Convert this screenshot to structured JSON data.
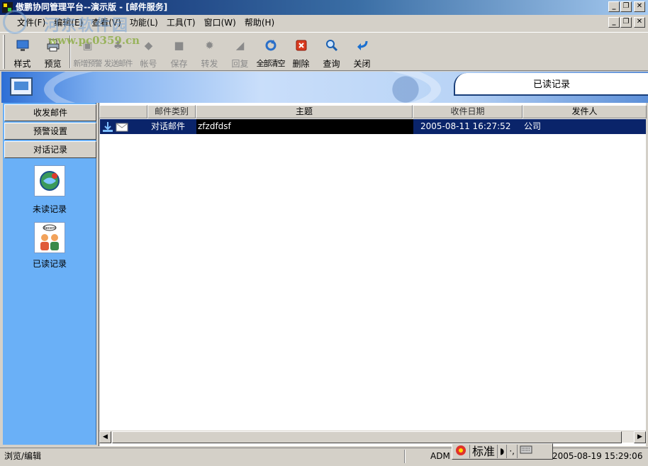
{
  "window": {
    "title": "傲鹏协同管理平台--演示版 - [邮件服务]",
    "minimize": "_",
    "restore": "❐",
    "close": "✕"
  },
  "watermark": {
    "url": "www.pc0359.cn",
    "site": "河东软件园"
  },
  "menu": [
    "文件(F)",
    "编辑(E)",
    "查看(V)",
    "功能(L)",
    "工具(T)",
    "窗口(W)",
    "帮助(H)"
  ],
  "toolbar": {
    "style": "样式",
    "preview": "预览",
    "new_warning": "新增预警",
    "send_mail": "发送邮件",
    "account": "帐号",
    "save": "保存",
    "forward": "转发",
    "reply": "回复",
    "clear_all": "全部清空",
    "delete": "删除",
    "query": "查询",
    "close": "关闭"
  },
  "banner": {
    "tab_title": "已读记录"
  },
  "leftnav": {
    "buttons": [
      "收发邮件",
      "预警设置",
      "对话记录"
    ],
    "items": [
      {
        "label": "未读记录",
        "icon": "unread-icon"
      },
      {
        "label": "已读记录",
        "icon": "read-icon",
        "icon_caption": "Recent"
      }
    ]
  },
  "table": {
    "columns": [
      "",
      "邮件类别",
      "主题",
      "收件日期",
      "发件人"
    ],
    "rows": [
      {
        "category": "对话邮件",
        "subject": "zfzdfdsf",
        "date": "2005-08-11 16:27:52",
        "sender": "公司"
      }
    ]
  },
  "status": {
    "mode": "浏览/编辑",
    "user": "ADM",
    "ime_mode": "标准",
    "datetime": "2005-08-19 15:29:06"
  },
  "colors": {
    "title_start": "#0a246a",
    "selection": "#0a246a",
    "nav_bg": "#6ab0f7"
  }
}
